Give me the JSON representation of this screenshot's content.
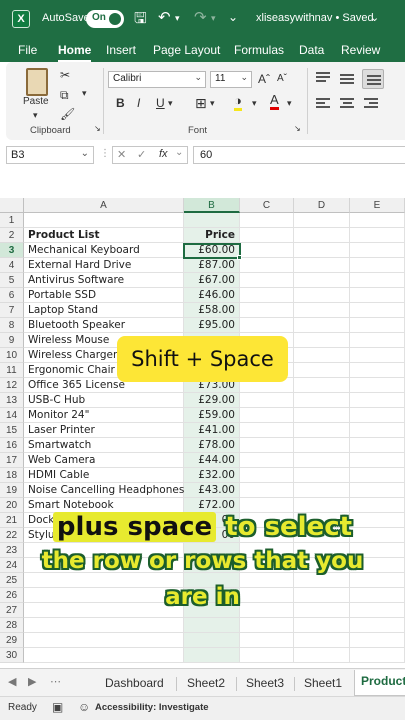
{
  "titlebar": {
    "app_icon": "X",
    "autosave_label": "AutoSave",
    "autosave_state": "On",
    "save_icon": "save-icon",
    "undo_icon": "undo-icon",
    "redo_icon": "redo-icon",
    "doc_title": "xliseasywithnav • Saved"
  },
  "ribbon_tabs": [
    "File",
    "Home",
    "Insert",
    "Page Layout",
    "Formulas",
    "Data",
    "Review"
  ],
  "ribbon": {
    "paste_label": "Paste",
    "clipboard_label": "Clipboard",
    "font_name": "Calibri",
    "font_size": "11",
    "bold": "B",
    "italic": "I",
    "underline": "U",
    "font_label": "Font"
  },
  "formula_bar": {
    "name_box": "B3",
    "fx": "fx",
    "value": "60"
  },
  "columns": [
    "A",
    "B",
    "C",
    "D",
    "E"
  ],
  "rows": [
    {
      "num": "1",
      "a": "",
      "b": ""
    },
    {
      "num": "2",
      "a": "Product List",
      "b": "Price"
    },
    {
      "num": "3",
      "a": "Mechanical Keyboard",
      "b": "£60.00"
    },
    {
      "num": "4",
      "a": "External Hard Drive",
      "b": "£87.00"
    },
    {
      "num": "5",
      "a": "Antivirus Software",
      "b": "£67.00"
    },
    {
      "num": "6",
      "a": "Portable SSD",
      "b": "£46.00"
    },
    {
      "num": "7",
      "a": "Laptop Stand",
      "b": "£58.00"
    },
    {
      "num": "8",
      "a": "Bluetooth Speaker",
      "b": "£95.00"
    },
    {
      "num": "9",
      "a": "Wireless Mouse",
      "b": ""
    },
    {
      "num": "10",
      "a": "Wireless Charger",
      "b": ""
    },
    {
      "num": "11",
      "a": "Ergonomic Chair",
      "b": ""
    },
    {
      "num": "12",
      "a": "Office 365 License",
      "b": "£73.00"
    },
    {
      "num": "13",
      "a": "USB-C Hub",
      "b": "£29.00"
    },
    {
      "num": "14",
      "a": "Monitor 24\"",
      "b": "£59.00"
    },
    {
      "num": "15",
      "a": "Laser Printer",
      "b": "£41.00"
    },
    {
      "num": "16",
      "a": "Smartwatch",
      "b": "£78.00"
    },
    {
      "num": "17",
      "a": "Web Camera",
      "b": "£44.00"
    },
    {
      "num": "18",
      "a": "HDMI Cable",
      "b": "£32.00"
    },
    {
      "num": "19",
      "a": "Noise Cancelling Headphones",
      "b": "£43.00"
    },
    {
      "num": "20",
      "a": "Smart Notebook",
      "b": "£72.00"
    },
    {
      "num": "21",
      "a": "Docki",
      "b": "00"
    },
    {
      "num": "22",
      "a": "Stylus",
      "b": "00"
    },
    {
      "num": "23",
      "a": "",
      "b": ""
    },
    {
      "num": "24",
      "a": "",
      "b": ""
    },
    {
      "num": "25",
      "a": "",
      "b": ""
    },
    {
      "num": "26",
      "a": "",
      "b": ""
    },
    {
      "num": "27",
      "a": "",
      "b": ""
    },
    {
      "num": "28",
      "a": "",
      "b": ""
    },
    {
      "num": "29",
      "a": "",
      "b": ""
    },
    {
      "num": "30",
      "a": "",
      "b": ""
    }
  ],
  "overlay": {
    "shortcut": "Shift + Space",
    "caption_highlight": "plus space",
    "caption_line1_rest": " to select",
    "caption_line2": "the row or rows that you",
    "caption_line3": "are in"
  },
  "sheet_tabs": [
    "Dashboard",
    "Sheet2",
    "Sheet3",
    "Sheet1",
    "Product"
  ],
  "status": {
    "ready": "Ready",
    "accessibility": "Accessibility: Investigate"
  },
  "colors": {
    "excel_green": "#1f6e43",
    "selection_green": "#1e6b41",
    "highlight_yellow": "#fde636"
  }
}
